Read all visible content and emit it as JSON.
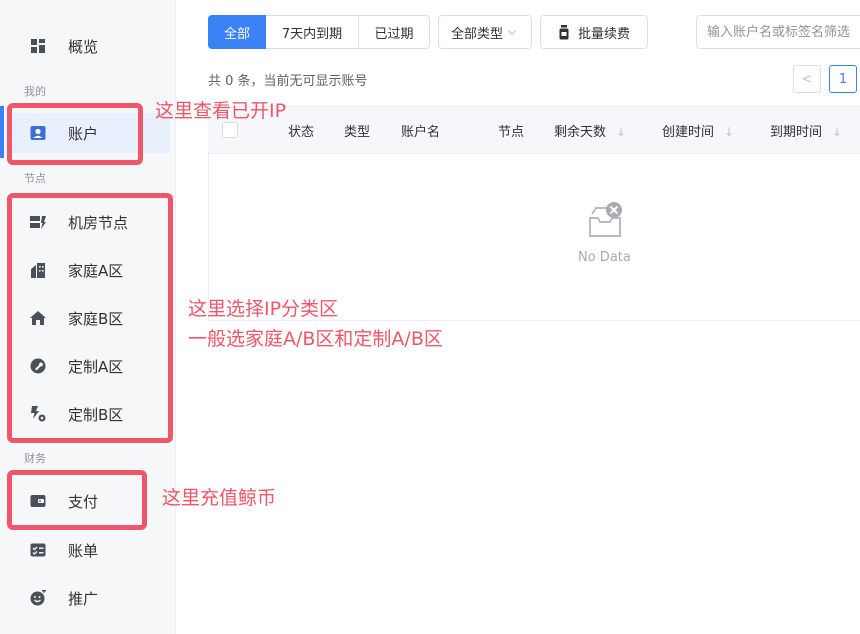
{
  "sidebar": {
    "overview": "概览",
    "section_mine": "我的",
    "account": "账户",
    "section_nodes": "节点",
    "datacenter": "机房节点",
    "home_a": "家庭A区",
    "home_b": "家庭B区",
    "custom_a": "定制A区",
    "custom_b": "定制B区",
    "section_finance": "财务",
    "payment": "支付",
    "bill": "账单",
    "promote": "推广"
  },
  "toolbar": {
    "tab_all": "全部",
    "tab_7days": "7天内到期",
    "tab_expired": "已过期",
    "type_select": "全部类型",
    "batch_renew": "批量续费",
    "search_placeholder": "输入账户名或标签名筛选"
  },
  "summary": {
    "count_text": "共 0 条，当前无可显示账号"
  },
  "pager": {
    "prev": "<",
    "current_page": "1"
  },
  "table": {
    "columns": [
      "状态",
      "类型",
      "账户名",
      "节点",
      "剩余天数",
      "创建时间",
      "到期时间"
    ],
    "empty_text": "No Data"
  },
  "annotations": {
    "account_note": "这里查看已开IP",
    "node_note_line1": "这里选择IP分类区",
    "node_note_line2": "一般选家庭A/B区和定制A/B区",
    "payment_note": "这里充值鲸币"
  },
  "colors": {
    "primary": "#3b82f6",
    "annotation": "#f0566a"
  }
}
